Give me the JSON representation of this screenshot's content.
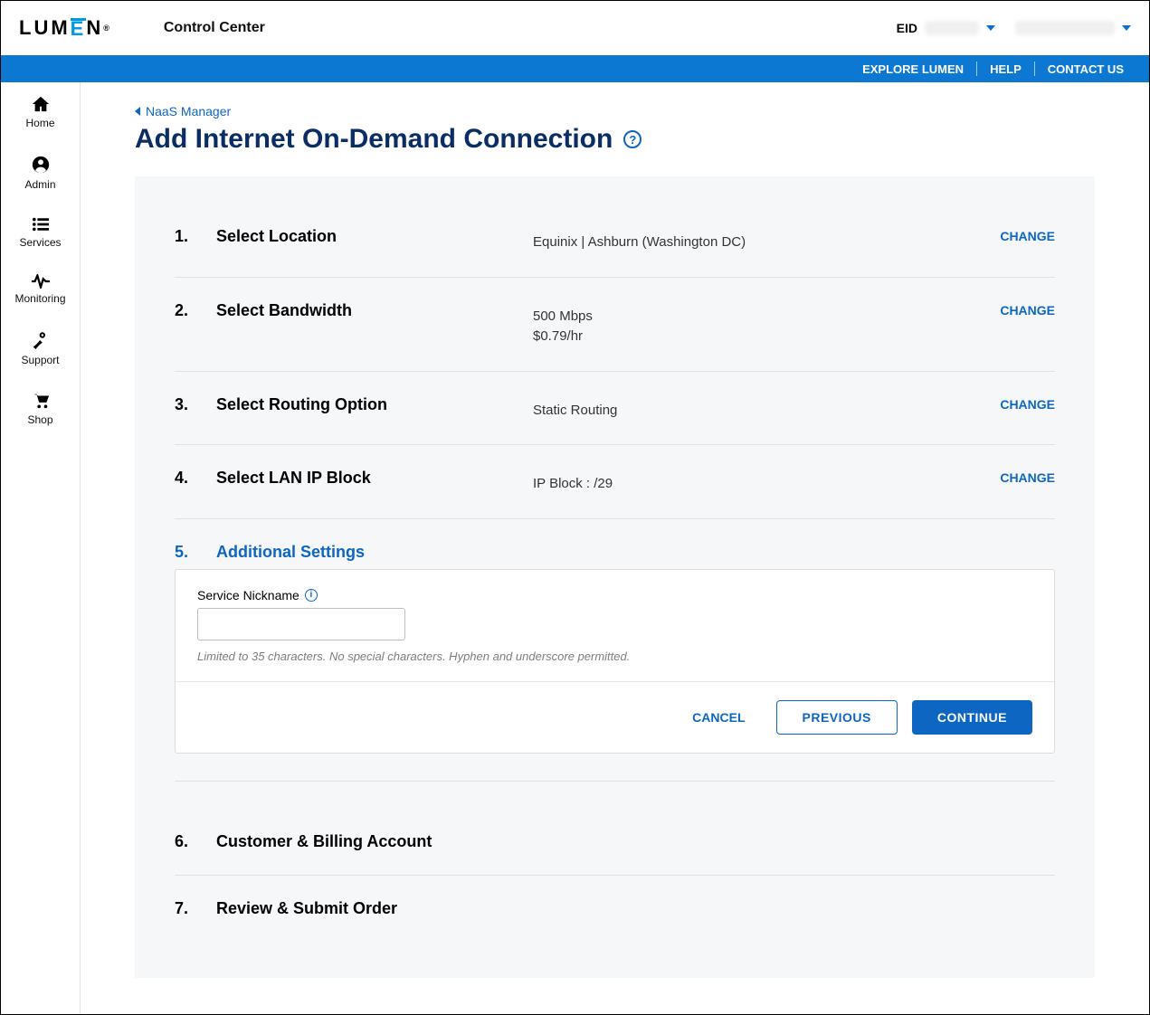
{
  "header": {
    "logo_text": "LUM",
    "logo_e": "E",
    "logo_text2": "N",
    "app_title": "Control Center",
    "eid_label": "EID"
  },
  "bluebar": {
    "explore": "EXPLORE LUMEN",
    "help": "HELP",
    "contact": "CONTACT US"
  },
  "sidebar": {
    "items": [
      {
        "label": "Home"
      },
      {
        "label": "Admin"
      },
      {
        "label": "Services"
      },
      {
        "label": "Monitoring"
      },
      {
        "label": "Support"
      },
      {
        "label": "Shop"
      }
    ]
  },
  "breadcrumb": {
    "label": "NaaS Manager"
  },
  "page_title": "Add Internet On-Demand Connection",
  "steps": {
    "s1": {
      "num": "1.",
      "title": "Select Location",
      "value": "Equinix | Ashburn (Washington DC)",
      "change": "CHANGE"
    },
    "s2": {
      "num": "2.",
      "title": "Select Bandwidth",
      "value1": "500 Mbps",
      "value2": "$0.79/hr",
      "change": "CHANGE"
    },
    "s3": {
      "num": "3.",
      "title": "Select Routing Option",
      "value": "Static Routing",
      "change": "CHANGE"
    },
    "s4": {
      "num": "4.",
      "title": "Select LAN IP Block",
      "value": "IP Block : /29",
      "change": "CHANGE"
    },
    "s5": {
      "num": "5.",
      "title": "Additional Settings"
    },
    "s6": {
      "num": "6.",
      "title": "Customer & Billing Account"
    },
    "s7": {
      "num": "7.",
      "title": "Review & Submit Order"
    }
  },
  "additional": {
    "field_label": "Service Nickname",
    "helper": "Limited to 35 characters. No special characters. Hyphen and underscore permitted.",
    "cancel": "CANCEL",
    "previous": "PREVIOUS",
    "continue": "CONTINUE"
  }
}
